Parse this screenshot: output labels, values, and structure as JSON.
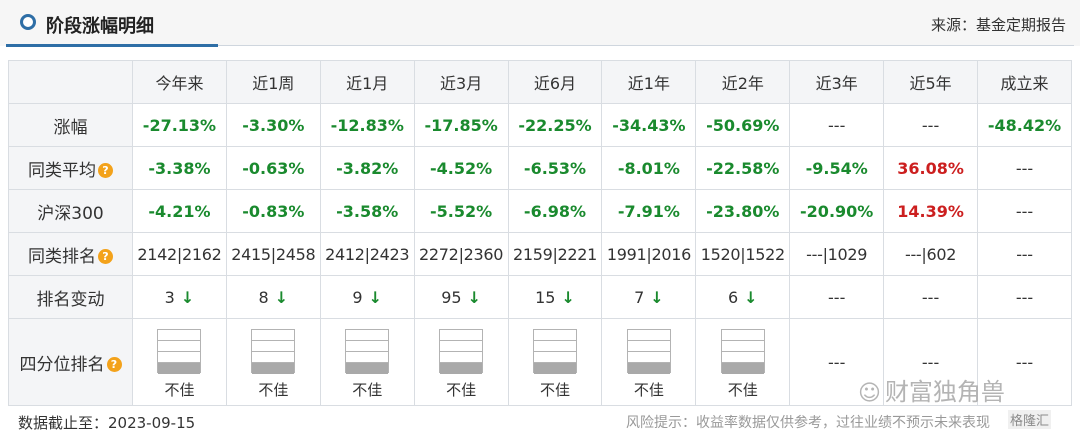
{
  "header": {
    "title": "阶段涨幅明细",
    "source": "来源：基金定期报告"
  },
  "columns": [
    "今年来",
    "近1周",
    "近1月",
    "近3月",
    "近6月",
    "近1年",
    "近2年",
    "近3年",
    "近5年",
    "成立来"
  ],
  "rows": {
    "gain": {
      "label": "涨幅",
      "cells": [
        {
          "v": "-27.13%",
          "c": "neg"
        },
        {
          "v": "-3.30%",
          "c": "neg"
        },
        {
          "v": "-12.83%",
          "c": "neg"
        },
        {
          "v": "-17.85%",
          "c": "neg"
        },
        {
          "v": "-22.25%",
          "c": "neg"
        },
        {
          "v": "-34.43%",
          "c": "neg"
        },
        {
          "v": "-50.69%",
          "c": "neg"
        },
        {
          "v": "---",
          "c": "dash"
        },
        {
          "v": "---",
          "c": "dash"
        },
        {
          "v": "-48.42%",
          "c": "neg"
        }
      ]
    },
    "peer_avg": {
      "label": "同类平均",
      "cells": [
        {
          "v": "-3.38%",
          "c": "neg"
        },
        {
          "v": "-0.63%",
          "c": "neg"
        },
        {
          "v": "-3.82%",
          "c": "neg"
        },
        {
          "v": "-4.52%",
          "c": "neg"
        },
        {
          "v": "-6.53%",
          "c": "neg"
        },
        {
          "v": "-8.01%",
          "c": "neg"
        },
        {
          "v": "-22.58%",
          "c": "neg"
        },
        {
          "v": "-9.54%",
          "c": "neg"
        },
        {
          "v": "36.08%",
          "c": "pos"
        },
        {
          "v": "---",
          "c": "dash"
        }
      ]
    },
    "hs300": {
      "label": "沪深300",
      "cells": [
        {
          "v": "-4.21%",
          "c": "neg"
        },
        {
          "v": "-0.83%",
          "c": "neg"
        },
        {
          "v": "-3.58%",
          "c": "neg"
        },
        {
          "v": "-5.52%",
          "c": "neg"
        },
        {
          "v": "-6.98%",
          "c": "neg"
        },
        {
          "v": "-7.91%",
          "c": "neg"
        },
        {
          "v": "-23.80%",
          "c": "neg"
        },
        {
          "v": "-20.90%",
          "c": "neg"
        },
        {
          "v": "14.39%",
          "c": "pos"
        },
        {
          "v": "---",
          "c": "dash"
        }
      ]
    },
    "peer_rank": {
      "label": "同类排名",
      "cells": [
        "2142|2162",
        "2415|2458",
        "2412|2423",
        "2272|2360",
        "2159|2221",
        "1991|2016",
        "1520|1522",
        "---|1029",
        "---|602",
        "---"
      ]
    },
    "rank_change": {
      "label": "排名变动",
      "cells": [
        {
          "v": "3",
          "arrow": "↓"
        },
        {
          "v": "8",
          "arrow": "↓"
        },
        {
          "v": "9",
          "arrow": "↓"
        },
        {
          "v": "95",
          "arrow": "↓"
        },
        {
          "v": "15",
          "arrow": "↓"
        },
        {
          "v": "7",
          "arrow": "↓"
        },
        {
          "v": "6",
          "arrow": "↓"
        },
        {
          "v": "---",
          "arrow": ""
        },
        {
          "v": "---",
          "arrow": ""
        },
        {
          "v": "---",
          "arrow": ""
        }
      ]
    },
    "quartile": {
      "label": "四分位排名",
      "cells": [
        {
          "text": "不佳",
          "show": true
        },
        {
          "text": "不佳",
          "show": true
        },
        {
          "text": "不佳",
          "show": true
        },
        {
          "text": "不佳",
          "show": true
        },
        {
          "text": "不佳",
          "show": true
        },
        {
          "text": "不佳",
          "show": true
        },
        {
          "text": "不佳",
          "show": true
        },
        {
          "text": "---",
          "show": false
        },
        {
          "text": "---",
          "show": false
        },
        {
          "text": "---",
          "show": false
        }
      ]
    }
  },
  "help_icon": {
    "symbol": "?",
    "name": "help-icon",
    "color": "#f3a21b"
  },
  "colors": {
    "negative": "#1a8a2e",
    "positive": "#cc1f1f",
    "accent": "#2e6ea6"
  },
  "footer": {
    "date": "数据截止至：2023-09-15",
    "risk": "风险提示：收益率数据仅供参考，过往业绩不预示未来表现"
  },
  "watermark": {
    "text": "财富独角兽",
    "text2": "格隆汇"
  }
}
